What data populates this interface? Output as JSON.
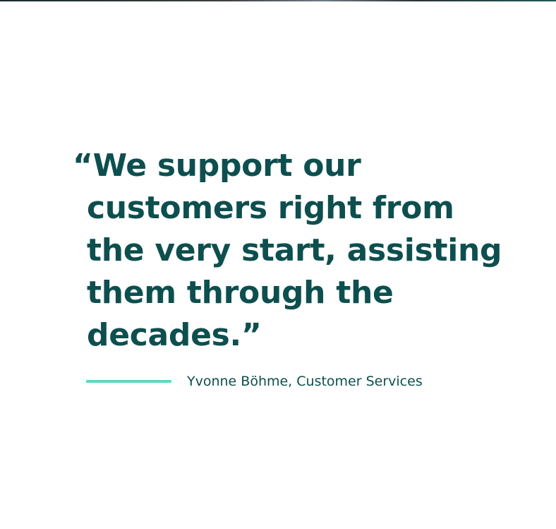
{
  "testimonial": {
    "quote_lines": [
      "“We support our",
      "customers right from",
      "the very start, assisting",
      "them through the",
      "decades.”"
    ],
    "attribution": "Yvonne Böhme, Customer Services"
  },
  "colors": {
    "quote_text": "#0d4f4e",
    "accent_rule": "#5fd9bd",
    "background": "#ffffff"
  }
}
